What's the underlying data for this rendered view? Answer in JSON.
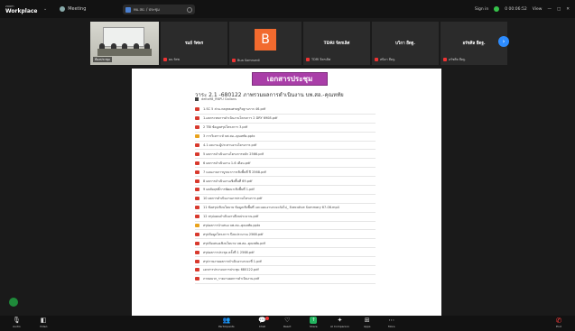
{
  "app": {
    "brand_small": "zoom",
    "brand_name": "Workplace",
    "meeting_label": "Meeting",
    "tab_label": "ทบ.สป. / ประชุม",
    "signal_text": "Sign in",
    "status_text": "0 00:06:52",
    "view_text": "View"
  },
  "participants": [
    {
      "type": "video",
      "name": "ห้องประชุม"
    },
    {
      "type": "standard",
      "name": "รมย์ รัศพร",
      "footer": "ผบ.รัศพ"
    },
    {
      "type": "avatar",
      "initial": "B",
      "footer": "Bua Somruedi"
    },
    {
      "type": "standard",
      "name": "TDRI จิตรเลิศ",
      "footer": "TDRI จิตรเลิศ"
    },
    {
      "type": "standard",
      "name": "บวิกา ยืดฐ.",
      "footer": "สนิดา ยืดฐ."
    },
    {
      "type": "standard",
      "name": "อรัชศิล ยืดฐ.",
      "footer": "อรัชศิล ยืดฐ."
    }
  ],
  "doc": {
    "heading": "เอกสารประชุม",
    "title": "วาระ 2.1 -680122 ภาพรวมผลการดำเนินงาน บพ.สอ.-คุณหทัย",
    "subtitle": "delta98_RNPU Gallans",
    "files": [
      {
        "type": "pdf",
        "name": "1.SC 5 ส่วน.กลยุทธเศรษฐกิจฐานราก 46.pdf"
      },
      {
        "type": "pdf",
        "name": "1-ผลกระทบการดำเนินงานโครงการ 2 DRY 6908.pdf"
      },
      {
        "type": "pdf",
        "name": "2 TBI ข้อมูลสรุปโครงการ 3.pdf"
      },
      {
        "type": "ppt",
        "name": "3 การวิเคราะห์ บพ.สอ.-คุณหทัย.pptx"
      },
      {
        "type": "pdf",
        "name": "4.1 ผลงาน.ผู้ประสานงานโครงการ.pdf"
      },
      {
        "type": "pdf",
        "name": "5 ผลการดำเนินงานโครงการหลัก 2566.pdf"
      },
      {
        "type": "pdf",
        "name": "6 ผลการดำเนินงาน 1-6 เดือน.pdf"
      },
      {
        "type": "pdf",
        "name": "7 แผนงานการบูรณาการเชิงพื้นที่ ปี 2568.pdf"
      },
      {
        "type": "pdf",
        "name": "8 ผลการดำเนินงานเชิงพื้นที่ 69.pdf"
      },
      {
        "type": "pdf",
        "name": "9 ผลสัมฤทธิ์การพัฒนาเชิงพื้นที่ 1.pdf"
      },
      {
        "type": "pdf",
        "name": "10 ผลการดำเนินงานภาพรวมโครงการ.pdf"
      },
      {
        "type": "pdf",
        "name": "11 ข้อสรุปเชิงนโยบาย ข้อมูลเชิงพื้นที่ และแผนงานระยะถัดไป_ Executive Summary 67-06.mp4"
      },
      {
        "type": "pdf",
        "name": "12 สรุปแผนดำเนินงานปีงบประมาณ.pdf"
      },
      {
        "type": "ppt",
        "name": "สรุปผลการนำเสนอ บพ.สอ.-คุณหทัย.pptx"
      },
      {
        "type": "pdf",
        "name": "สรุปข้อมูลโครงการ ปีงบประมาณ 2568.pdf"
      },
      {
        "type": "pdf",
        "name": "สรุปข้อเสนอเชิงนโยบาย บพ.สอ.-คุณหทัย.pdf"
      },
      {
        "type": "pdf",
        "name": "สรุปผลการประชุม ครั้งที่ 1 2568.pdf"
      },
      {
        "type": "pdf",
        "name": "สรุปรายงานผลการดำเนินงานระยะที่ 1.pdf"
      },
      {
        "type": "pdf",
        "name": "เอกสารประกอบการประชุม 680122.pdf"
      },
      {
        "type": "pdf",
        "name": "ภาคผนวก_รายงานผลการดำเนินงาน.pdf"
      }
    ]
  },
  "toolbar": {
    "audio": "Audio",
    "video": "Video",
    "participants_count": "11",
    "participants": "Participants",
    "chat": "Chat",
    "react": "React",
    "share": "Share",
    "ai_companion": "AI Companion",
    "apps": "Apps",
    "more": "More",
    "end": "End"
  }
}
